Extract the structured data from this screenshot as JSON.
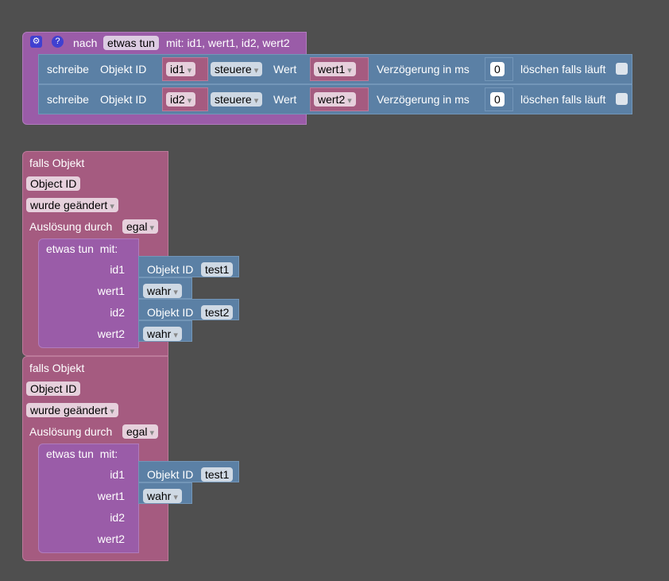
{
  "procedure": {
    "prefix": "nach",
    "name": "etwas tun",
    "params": "mit: id1, wert1, id2, wert2",
    "rows": [
      {
        "label": "schreibe",
        "obj": "Objekt ID",
        "id": "id1",
        "mode": "steuere",
        "wert_label": "Wert",
        "wert": "wert1",
        "delay_label": "Verzögerung in ms",
        "delay": "0",
        "clear_label": "löschen falls läuft"
      },
      {
        "label": "schreibe",
        "obj": "Objekt ID",
        "id": "id2",
        "mode": "steuere",
        "wert_label": "Wert",
        "wert": "wert2",
        "delay_label": "Verzögerung in ms",
        "delay": "0",
        "clear_label": "löschen falls läuft"
      }
    ]
  },
  "triggers": [
    {
      "title": "falls Objekt",
      "object": "Object ID",
      "event": "wurde geändert",
      "by_label": "Auslösung durch",
      "by": "egal",
      "call": "etwas tun  mit:",
      "args": [
        {
          "name": "id1",
          "obj": "Objekt ID",
          "val": "test1"
        },
        {
          "name": "wert1",
          "val": "wahr"
        },
        {
          "name": "id2",
          "obj": "Objekt ID",
          "val": "test2"
        },
        {
          "name": "wert2",
          "val": "wahr"
        }
      ]
    },
    {
      "title": "falls Objekt",
      "object": "Object ID",
      "event": "wurde geändert",
      "by_label": "Auslösung durch",
      "by": "egal",
      "call": "etwas tun  mit:",
      "args": [
        {
          "name": "id1",
          "obj": "Objekt ID",
          "val": "test1"
        },
        {
          "name": "wert1",
          "val": "wahr"
        },
        {
          "name": "id2"
        },
        {
          "name": "wert2"
        }
      ]
    }
  ]
}
